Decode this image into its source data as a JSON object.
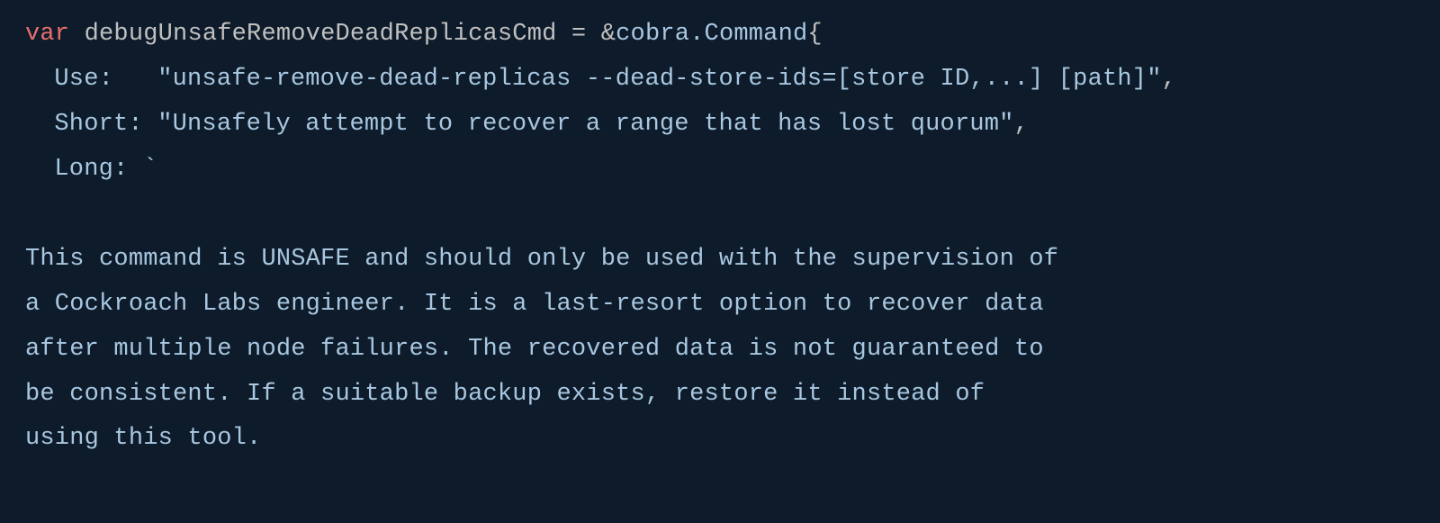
{
  "code": {
    "line1": {
      "keyword": "var",
      "ident": "debugUnsafeRemoveDeadReplicasCmd",
      "eq": " = ",
      "amp": "&",
      "pkg": "cobra.Command",
      "brace": "{"
    },
    "line2": {
      "field": "Use:   ",
      "value": "\"unsafe-remove-dead-replicas --dead-store-ids=[store ID,...] [path]\"",
      "comma": ","
    },
    "line3": {
      "field": "Short: ",
      "value": "\"Unsafely attempt to recover a range that has lost quorum\"",
      "comma": ","
    },
    "line4": {
      "field": "Long: ",
      "backtick": "`"
    },
    "body1": "This command is UNSAFE and should only be used with the supervision of",
    "body2": "a Cockroach Labs engineer. It is a last-resort option to recover data",
    "body3": "after multiple node failures. The recovered data is not guaranteed to",
    "body4": "be consistent. If a suitable backup exists, restore it instead of",
    "body5": "using this tool."
  }
}
